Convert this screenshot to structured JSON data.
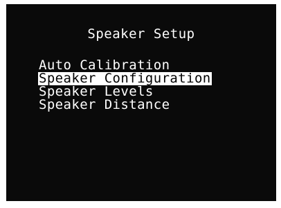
{
  "menu": {
    "title": "Speaker Setup",
    "items": [
      {
        "label": "Auto Calibration",
        "selected": false
      },
      {
        "label": "Speaker Configuration",
        "selected": true
      },
      {
        "label": "Speaker Levels",
        "selected": false
      },
      {
        "label": "Speaker Distance",
        "selected": false
      }
    ]
  },
  "colors": {
    "screen_background": "#0a0a0a",
    "text": "#ffffff",
    "highlight_background": "#ffffff",
    "highlight_text": "#000000"
  }
}
